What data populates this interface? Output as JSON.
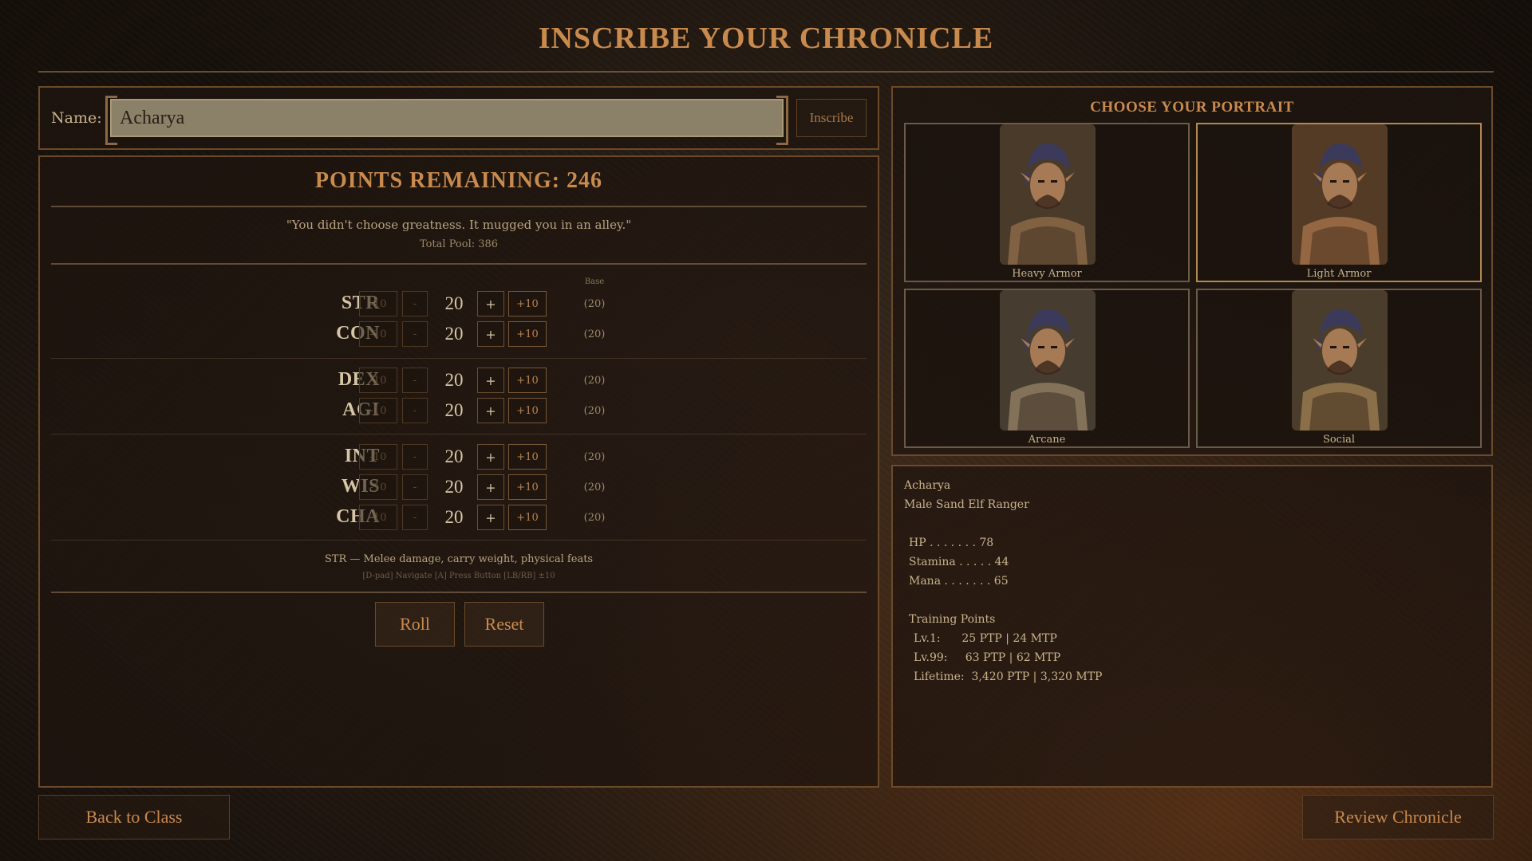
{
  "title": "Inscribe Your Chronicle",
  "name_bar": {
    "label": "Name:",
    "value": "Acharya",
    "button": "Inscribe"
  },
  "points": {
    "title": "Points Remaining: 246",
    "quote": "\"You didn't choose greatness. It mugged you in an alley.\"",
    "pool": "Total Pool: 386",
    "base_header": "Base"
  },
  "stats": [
    {
      "name": "STR",
      "value": "20",
      "base": "(20)"
    },
    {
      "name": "CON",
      "value": "20",
      "base": "(20)"
    },
    {
      "name": "DEX",
      "value": "20",
      "base": "(20)"
    },
    {
      "name": "AGI",
      "value": "20",
      "base": "(20)"
    },
    {
      "name": "INT",
      "value": "20",
      "base": "(20)"
    },
    {
      "name": "WIS",
      "value": "20",
      "base": "(20)"
    },
    {
      "name": "CHA",
      "value": "20",
      "base": "(20)"
    }
  ],
  "stat_buttons": {
    "minus10": "-10",
    "minus1": "-",
    "plus1": "+",
    "plus10": "+10"
  },
  "stat_description": "STR — Melee damage, carry weight, physical feats",
  "controls_hint": "[D-pad] Navigate   [A] Press Button   [LB/RB] ±10",
  "actions": {
    "roll": "Roll",
    "reset": "Reset"
  },
  "portraits": {
    "title": "Choose Your Portrait",
    "items": [
      {
        "label": "Heavy Armor",
        "selected": false
      },
      {
        "label": "Light Armor",
        "selected": true
      },
      {
        "label": "Arcane",
        "selected": false
      },
      {
        "label": "Social",
        "selected": false
      }
    ]
  },
  "summary": {
    "name": "Acharya",
    "description": "Male Sand Elf Ranger",
    "hp": "HP . . . . . . . 78",
    "stamina": "Stamina . . . . . 44",
    "mana": "Mana . . . . . . . 65",
    "training_title": "Training Points",
    "lv1": "Lv.1:      25 PTP | 24 MTP",
    "lv99": "Lv.99:     63 PTP | 62 MTP",
    "lifetime": "Lifetime:  3,420 PTP | 3,320 MTP"
  },
  "footer": {
    "back": "Back to Class",
    "review": "Review Chronicle"
  },
  "colors": {
    "accent": "#c98a4e",
    "text": "#c9b38c",
    "border": "#6b4a2a",
    "input_bg": "#8b8068"
  }
}
